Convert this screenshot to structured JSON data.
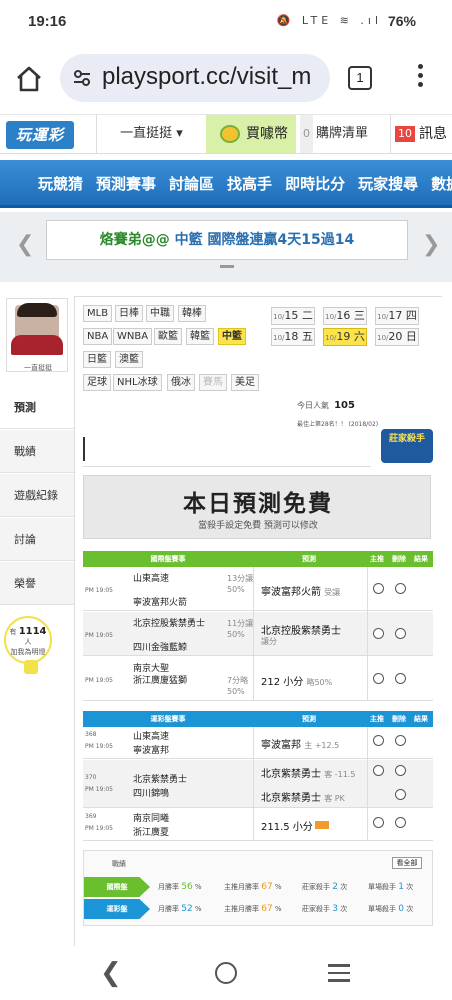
{
  "status_bar": {
    "time": "19:16",
    "icons": "🔕 LTE ≋ .ıl",
    "battery": "76%"
  },
  "browser": {
    "url": "playsport.cc/visit_m",
    "tab_count": "1"
  },
  "site_top": {
    "logo": "玩運彩",
    "follow": "一直挺挺 ▾",
    "buy": "買噱幣",
    "cart_count": "0",
    "cart_label": "購牌清單",
    "msg_count": "10",
    "msg_label": "訊息"
  },
  "nav": {
    "items": [
      "玩競猜",
      "預測賽事",
      "討論區",
      "找高手",
      "即時比分",
      "玩家搜尋",
      "數據"
    ]
  },
  "ticker": {
    "prefix": "烙賽弟@@",
    "league": "中籃",
    "text": "國際盤連贏4天15過14"
  },
  "side": {
    "user_name": "一直挺挺",
    "items": [
      "預測",
      "戰績",
      "遊戲紀錄",
      "討論",
      "榮譽"
    ],
    "fans_prefix": "有",
    "fans_count": "1114",
    "fans_unit": "人",
    "fans_text": "加我為明燈"
  },
  "leagues": {
    "row1": [
      "MLB",
      "日棒",
      "中職",
      "韓棒"
    ],
    "row2": [
      "NBA",
      "WNBA",
      "歐籃",
      "韓籃",
      "中籃"
    ],
    "row3": [
      "日籃",
      "澳籃"
    ],
    "row4": [
      "足球",
      "NHL冰球",
      "俄冰",
      "賽馬",
      "美足"
    ],
    "selected": "中籃"
  },
  "dates": [
    {
      "md": "10/",
      "d": "15",
      "wd": "二"
    },
    {
      "md": "10/",
      "d": "16",
      "wd": "三"
    },
    {
      "md": "10/",
      "d": "17",
      "wd": "四"
    },
    {
      "md": "10/",
      "d": "18",
      "wd": "五"
    },
    {
      "md": "10/",
      "d": "19",
      "wd": "六"
    },
    {
      "md": "10/",
      "d": "20",
      "wd": "日"
    }
  ],
  "info": {
    "visitors_label": "今日人氣",
    "visitors": "105",
    "rank_text": "最佳上第28名！！ (2018/02)",
    "badge": "莊家殺手"
  },
  "banner": {
    "title": "本日預測免費",
    "subtitle": "當殺手設定免費 預測可以修改"
  },
  "intl_table": {
    "headers": [
      "國際盤賽事",
      "預測",
      "主推",
      "刪除",
      "結果"
    ],
    "color": "#6abf2e",
    "rows": [
      {
        "time": "PM 19:05",
        "home": "山東高速",
        "away": "寧波富邦火箭",
        "away_sub": "(主)",
        "odds": "13分讓",
        "pct": "50%",
        "pred": "寧波富邦火箭",
        "pred_note": "受讓",
        "pred2": "",
        "pred2_note": ""
      },
      {
        "time": "PM 19:05",
        "home": "北京控股紫禁勇士",
        "away": "四川金強藍鯨",
        "away_sub": "(主)",
        "odds": "11分讓",
        "pct": "50%",
        "pred": "北京控股紫禁勇士",
        "pred_note": "讓分",
        "pred2": "",
        "pred2_note": ""
      },
      {
        "time": "PM 19:05",
        "home": "南京大聖",
        "away": "浙江廣廈猛獅",
        "away_sub": "(主)",
        "odds": "7分略",
        "pct": "50%",
        "pred": "212 小分",
        "pred_note": "略50%",
        "pred2": "",
        "pred2_note": ""
      }
    ]
  },
  "tw_table": {
    "headers": [
      "運彩盤賽事",
      "預測",
      "主推",
      "刪除",
      "結果"
    ],
    "color": "#1c95d6",
    "rows": [
      {
        "num": "368",
        "time": "PM 19:05",
        "home": "山東高速",
        "away": "寧波富邦",
        "away_sub": "(主)",
        "pred": "寧波富邦",
        "pred_note": "主 +12.5"
      },
      {
        "num": "370",
        "time": "PM 19:05",
        "home": "北京紫禁勇士",
        "away": "四川錦鳴",
        "away_sub": "(主)",
        "pred": "北京紫禁勇士",
        "pred_note": "客 -11.5",
        "pred2": "北京紫禁勇士",
        "pred2_note": "客 PK"
      },
      {
        "num": "369",
        "time": "PM 19:05",
        "home": "南京同曦",
        "away": "浙江廣夏",
        "away_sub": "(主)",
        "pred": "211.5 小分",
        "pred_note": ""
      }
    ]
  },
  "stats": {
    "label": "戰績",
    "all_button": "看全部",
    "rows": [
      {
        "tag": "國際盤",
        "color": "#6abf2e",
        "month_label": "月勝率",
        "month": "56",
        "main_label": "主推月勝率",
        "main": "67",
        "killer_label": "莊家殺手",
        "killer": "2",
        "single_label": "單場殺手",
        "single": "1",
        "unit": "次"
      },
      {
        "tag": "運彩盤",
        "color": "#1c95d6",
        "month_label": "月勝率",
        "month": "52",
        "main_label": "主推月勝率",
        "main": "67",
        "killer_label": "莊家殺手",
        "killer": "3",
        "single_label": "單場殺手",
        "single": "0",
        "unit": "次"
      }
    ]
  }
}
